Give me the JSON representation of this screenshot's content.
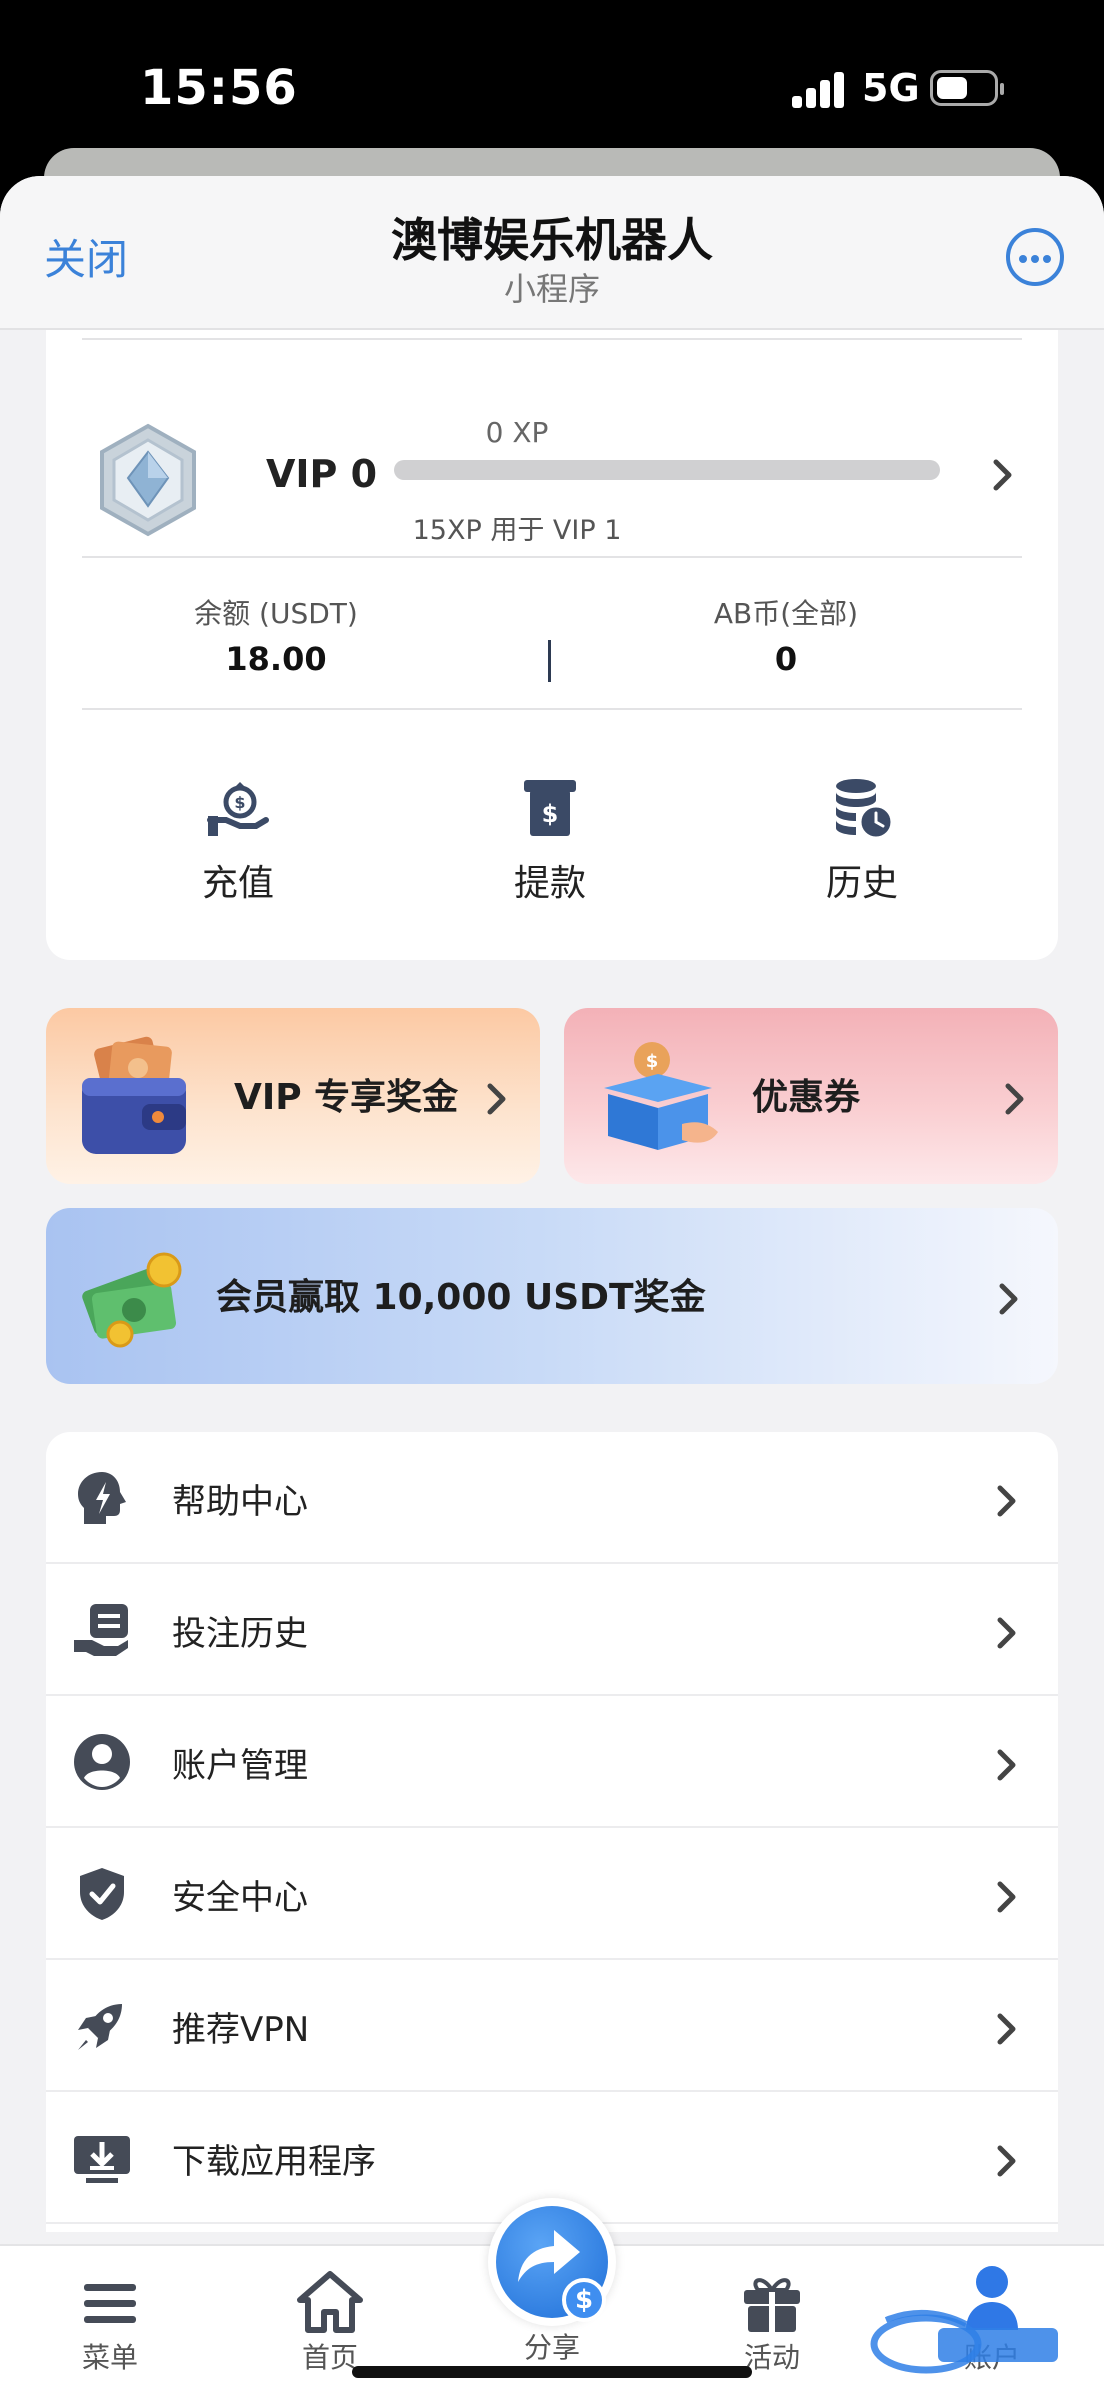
{
  "status_bar": {
    "time": "15:56",
    "network": "5G"
  },
  "nav": {
    "close_label": "关闭",
    "title": "澳博娱乐机器人",
    "subtitle": "小程序"
  },
  "vip": {
    "level": "VIP 0",
    "xp": "0 XP",
    "xp_progress": 0.0,
    "next_level": "15XP 用于 VIP 1"
  },
  "balances": [
    {
      "label": "余额 (USDT)",
      "value": "18.00"
    },
    {
      "label": "AB币(全部)",
      "value": "0"
    }
  ],
  "actions": [
    {
      "label": "充值",
      "icon": "hand-money-bag-icon"
    },
    {
      "label": "提款",
      "icon": "atm-withdraw-icon"
    },
    {
      "label": "历史",
      "icon": "coins-clock-icon"
    }
  ],
  "promos": {
    "vip_bonus": "VIP 专享奖金",
    "coupon": "优惠券",
    "member": "会员赢取 10,000 USDT奖金"
  },
  "menu": [
    {
      "label": "帮助中心",
      "icon": "help-head-icon"
    },
    {
      "label": "投注历史",
      "icon": "bet-history-icon"
    },
    {
      "label": "账户管理",
      "icon": "user-circle-icon"
    },
    {
      "label": "安全中心",
      "icon": "shield-check-icon"
    },
    {
      "label": "推荐VPN",
      "icon": "rocket-icon"
    },
    {
      "label": "下载应用程序",
      "icon": "download-icon"
    }
  ],
  "tabbar": {
    "menu": "菜单",
    "home": "首页",
    "share": "分享",
    "activity": "活动",
    "account": "账户"
  },
  "colors": {
    "accent": "#3b82d9",
    "page_bg": "#f2f2f4"
  }
}
